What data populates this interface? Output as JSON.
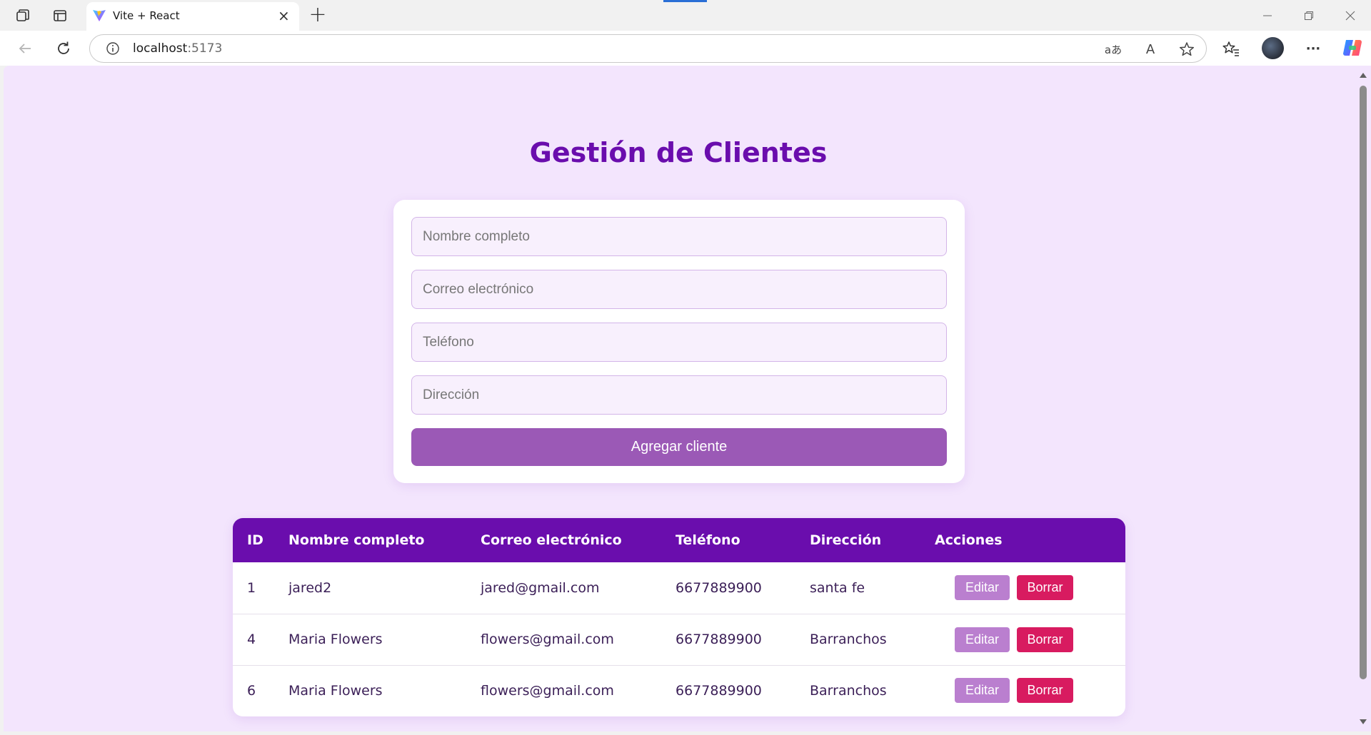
{
  "browser": {
    "tab_title": "Vite + React",
    "close_glyph": "×",
    "new_tab_glyph": "+",
    "address_host": "localhost",
    "address_port": ":5173",
    "read_aloud_glyph": "A",
    "menu_glyph": "···",
    "translate_glyph": "aあ"
  },
  "page": {
    "title": "Gestión de Clientes"
  },
  "form": {
    "name_placeholder": "Nombre completo",
    "email_placeholder": "Correo electrónico",
    "phone_placeholder": "Teléfono",
    "address_placeholder": "Dirección",
    "submit_label": "Agregar cliente"
  },
  "table": {
    "headers": [
      "ID",
      "Nombre completo",
      "Correo electrónico",
      "Teléfono",
      "Dirección",
      "Acciones"
    ],
    "rows": [
      {
        "id": "1",
        "name": "jared2",
        "email": "jared@gmail.com",
        "phone": "6677889900",
        "address": "santa fe"
      },
      {
        "id": "4",
        "name": "Maria Flowers",
        "email": "flowers@gmail.com",
        "phone": "6677889900",
        "address": "Barranchos"
      },
      {
        "id": "6",
        "name": "Maria Flowers",
        "email": "flowers@gmail.com",
        "phone": "6677889900",
        "address": "Barranchos"
      }
    ],
    "edit_label": "Editar",
    "delete_label": "Borrar"
  },
  "colors": {
    "accent": "#6a0dad",
    "page_bg": "#f3e5fd",
    "submit": "#9b59b6",
    "edit": "#ba7fcf",
    "delete": "#d81b60"
  },
  "icons": {
    "workspaces": "workspaces-icon",
    "tab_actions": "tab-actions-icon",
    "favicon": "vite-logo-icon",
    "back": "back-arrow-icon",
    "refresh": "refresh-icon",
    "info": "info-icon",
    "translate": "translate-icon",
    "read_aloud": "read-aloud-icon",
    "favorite": "star-icon",
    "favorites": "favorites-list-icon",
    "profile": "profile-avatar",
    "more": "more-icon",
    "copilot": "copilot-icon",
    "minimize": "minimize-icon",
    "restore": "restore-icon",
    "close_window": "close-window-icon"
  }
}
